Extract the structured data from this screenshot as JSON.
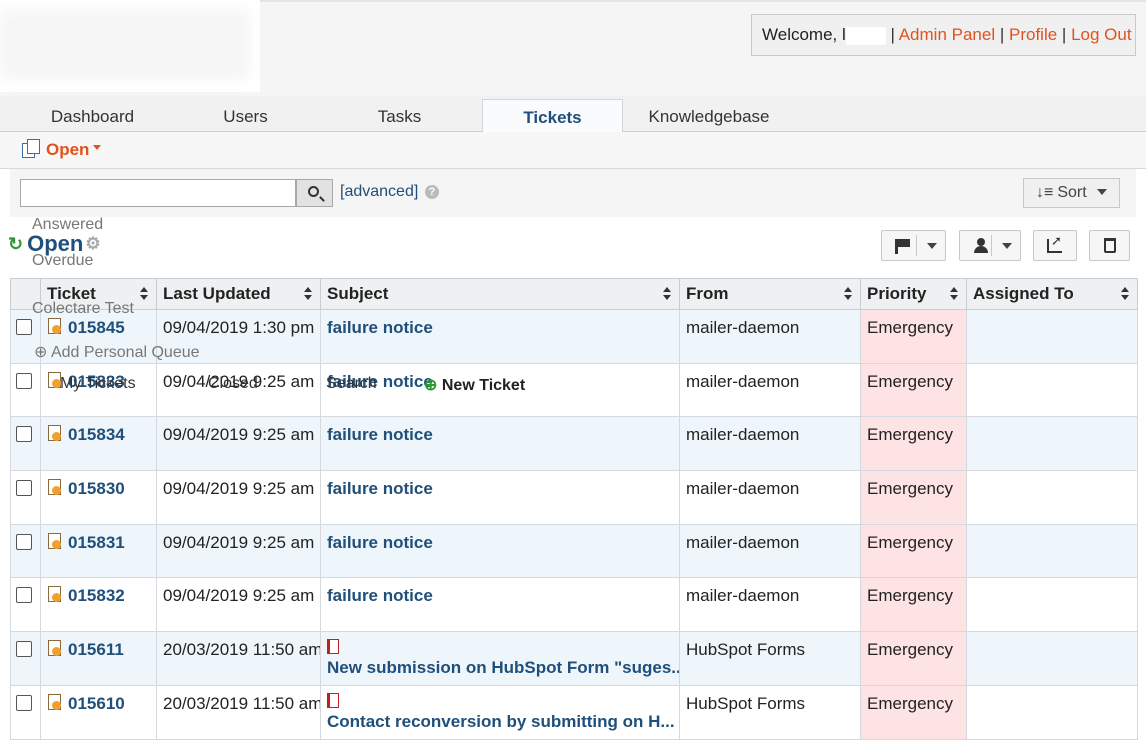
{
  "header": {
    "welcome": "Welcome, l",
    "admin_panel": "Admin Panel",
    "profile": "Profile",
    "log_out": "Log Out",
    "sep": "|"
  },
  "tabs": [
    "Dashboard",
    "Users",
    "Tasks",
    "Tickets",
    "Knowledgebase"
  ],
  "subnav": {
    "open": "Open",
    "ghost_items": [
      "My Tickets",
      "Closed",
      "Search",
      "New Ticket"
    ],
    "ghost_queues": [
      "Answered",
      "Overdue",
      "Colectare Test",
      "Add Personal Queue"
    ]
  },
  "search": {
    "value": "",
    "advanced": "[advanced]",
    "sort": "Sort",
    "help": "?"
  },
  "queue": {
    "title": "Open"
  },
  "table": {
    "columns": [
      "Ticket",
      "Last Updated",
      "Subject",
      "From",
      "Priority",
      "Assigned To"
    ],
    "rows": [
      {
        "ticket": "015845",
        "updated": "09/04/2019 1:30 pm",
        "subject": "failure notice",
        "from": "mailer-daemon",
        "priority": "Emergency",
        "assigned": "",
        "attach": false
      },
      {
        "ticket": "015833",
        "updated": "09/04/2019 9:25 am",
        "subject": "failure notice",
        "from": "mailer-daemon",
        "priority": "Emergency",
        "assigned": "",
        "attach": false
      },
      {
        "ticket": "015834",
        "updated": "09/04/2019 9:25 am",
        "subject": "failure notice",
        "from": "mailer-daemon",
        "priority": "Emergency",
        "assigned": "",
        "attach": false
      },
      {
        "ticket": "015830",
        "updated": "09/04/2019 9:25 am",
        "subject": "failure notice",
        "from": "mailer-daemon",
        "priority": "Emergency",
        "assigned": "",
        "attach": false
      },
      {
        "ticket": "015831",
        "updated": "09/04/2019 9:25 am",
        "subject": "failure notice",
        "from": "mailer-daemon",
        "priority": "Emergency",
        "assigned": "",
        "attach": false
      },
      {
        "ticket": "015832",
        "updated": "09/04/2019 9:25 am",
        "subject": "failure notice",
        "from": "mailer-daemon",
        "priority": "Emergency",
        "assigned": "",
        "attach": false
      },
      {
        "ticket": "015611",
        "updated": "20/03/2019 11:50 am",
        "subject": "New submission on HubSpot Form \"suges...",
        "from": "HubSpot Forms",
        "priority": "Emergency",
        "assigned": "",
        "attach": true
      },
      {
        "ticket": "015610",
        "updated": "20/03/2019 11:50 am",
        "subject": "Contact reconversion by submitting on H...",
        "from": "HubSpot Forms",
        "priority": "Emergency",
        "assigned": "",
        "attach": true
      }
    ]
  },
  "colors": {
    "accent": "#e0531e",
    "link": "#1f4f7a",
    "priority_bg": "#fde3e3",
    "row_alt": "#eef6fb"
  }
}
